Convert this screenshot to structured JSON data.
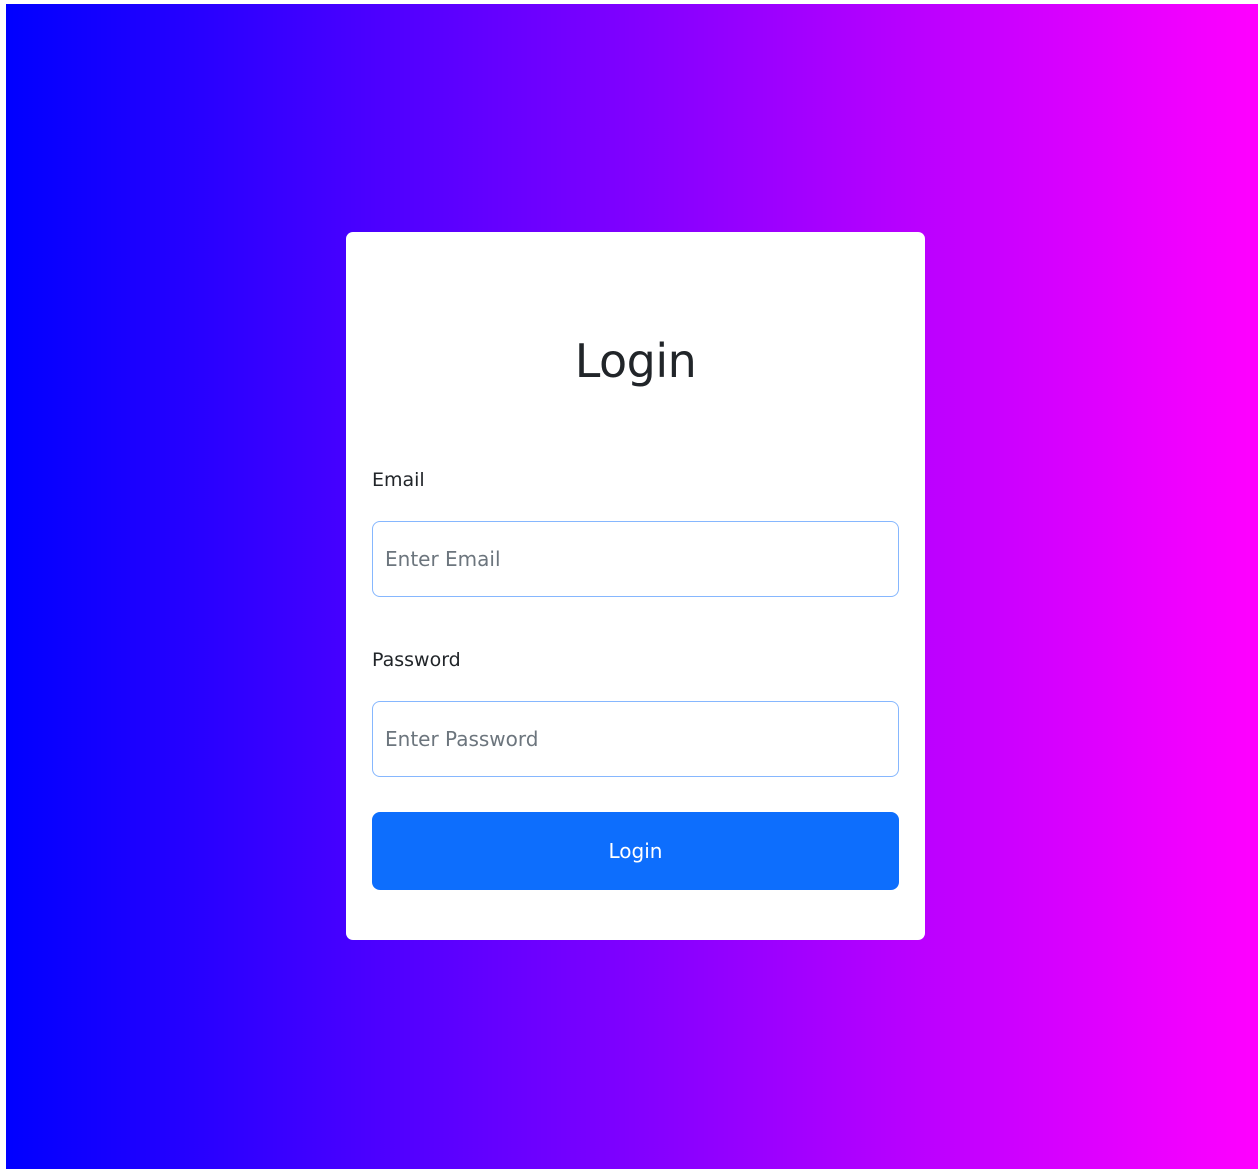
{
  "colors": {
    "gradient_start": "#0000ff",
    "gradient_end": "#ff00ff",
    "card_background": "#ffffff",
    "button_background": "#0d6efd",
    "input_border": "#86b7fe"
  },
  "login_card": {
    "title": "Login",
    "email": {
      "label": "Email",
      "placeholder": "Enter Email",
      "value": ""
    },
    "password": {
      "label": "Password",
      "placeholder": "Enter Password",
      "value": ""
    },
    "submit_label": "Login"
  }
}
